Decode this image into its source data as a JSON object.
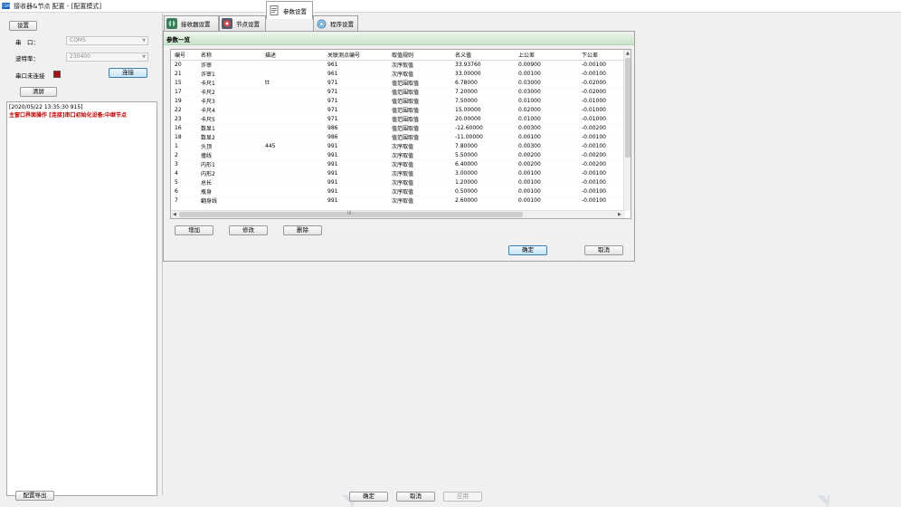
{
  "window": {
    "icon_text": "CSM",
    "title": "接收器&节点 配置 - [配置模式]"
  },
  "left": {
    "settings_button": "设置",
    "port_label": "串　口：",
    "port_value": "COM5",
    "baud_label": "波特率：",
    "baud_value": "230400",
    "status_label": "串口未连接",
    "connect_button": "连接",
    "clear_button": "清屏",
    "log": {
      "time": "[2020/05/22 13:35:30 915]",
      "message": "主窗口界面操作 [连接]串口初始化设备:中继节点"
    },
    "export_button": "配置导出"
  },
  "tabs": [
    {
      "label": "接收器设置"
    },
    {
      "label": "节点设置"
    },
    {
      "label": "参数设置"
    },
    {
      "label": "程序设置"
    }
  ],
  "params": {
    "group_title": "参数一览",
    "columns": [
      "编号",
      "名称",
      "描述",
      "关联测点编号",
      "取值规则",
      "名义值",
      "上公差",
      "下公差"
    ],
    "rows": [
      [
        "20",
        "诈审",
        "",
        "961",
        "次序取值",
        "33.93760",
        "0.00900",
        "-0.00100"
      ],
      [
        "21",
        "诈审1",
        "",
        "961",
        "次序取值",
        "33.00000",
        "0.00100",
        "-0.00100"
      ],
      [
        "15",
        "卡尺1",
        "tt",
        "971",
        "值范围取值",
        "6.78000",
        "0.03000",
        "-0.02000"
      ],
      [
        "17",
        "卡尺2",
        "",
        "971",
        "值范围取值",
        "7.20000",
        "0.03000",
        "-0.02000"
      ],
      [
        "19",
        "卡尺3",
        "",
        "971",
        "值范围取值",
        "7.50000",
        "0.01000",
        "-0.01000"
      ],
      [
        "22",
        "卡尺4",
        "",
        "971",
        "值范围取值",
        "15.00000",
        "0.02000",
        "-0.01000"
      ],
      [
        "23",
        "卡尺5",
        "",
        "971",
        "值范围取值",
        "20.00000",
        "0.01000",
        "-0.01000"
      ],
      [
        "16",
        "数显1",
        "",
        "986",
        "值范围取值",
        "-12.60000",
        "0.00300",
        "-0.00200"
      ],
      [
        "18",
        "数显2",
        "",
        "986",
        "值范围取值",
        "-11.00000",
        "0.00100",
        "-0.00100"
      ],
      [
        "1",
        "头顶",
        "445",
        "991",
        "次序取值",
        "7.80000",
        "0.00300",
        "-0.00100"
      ],
      [
        "2",
        "撞线",
        "",
        "991",
        "次序取值",
        "5.50000",
        "0.00200",
        "-0.00200"
      ],
      [
        "3",
        "内形1",
        "",
        "991",
        "次序取值",
        "6.40000",
        "0.00200",
        "-0.00200"
      ],
      [
        "4",
        "内形2",
        "",
        "991",
        "次序取值",
        "3.00000",
        "0.00100",
        "-0.00100"
      ],
      [
        "5",
        "总长",
        "",
        "991",
        "次序取值",
        "1.20000",
        "0.00100",
        "-0.00100"
      ],
      [
        "6",
        "瓶身",
        "",
        "991",
        "次序取值",
        "0.50000",
        "0.00100",
        "-0.00100"
      ],
      [
        "7",
        "翻身线",
        "",
        "991",
        "次序取值",
        "2.60000",
        "0.00100",
        "-0.00100"
      ]
    ],
    "add_button": "增加",
    "edit_button": "修改",
    "delete_button": "删除",
    "ok_button": "确定",
    "cancel_button": "取消",
    "hscroll_thumb_label": "III"
  },
  "footer": {
    "ok_button": "确定",
    "cancel_button": "取消",
    "apply_button": "应用"
  },
  "watermark_text": "y-tran"
}
